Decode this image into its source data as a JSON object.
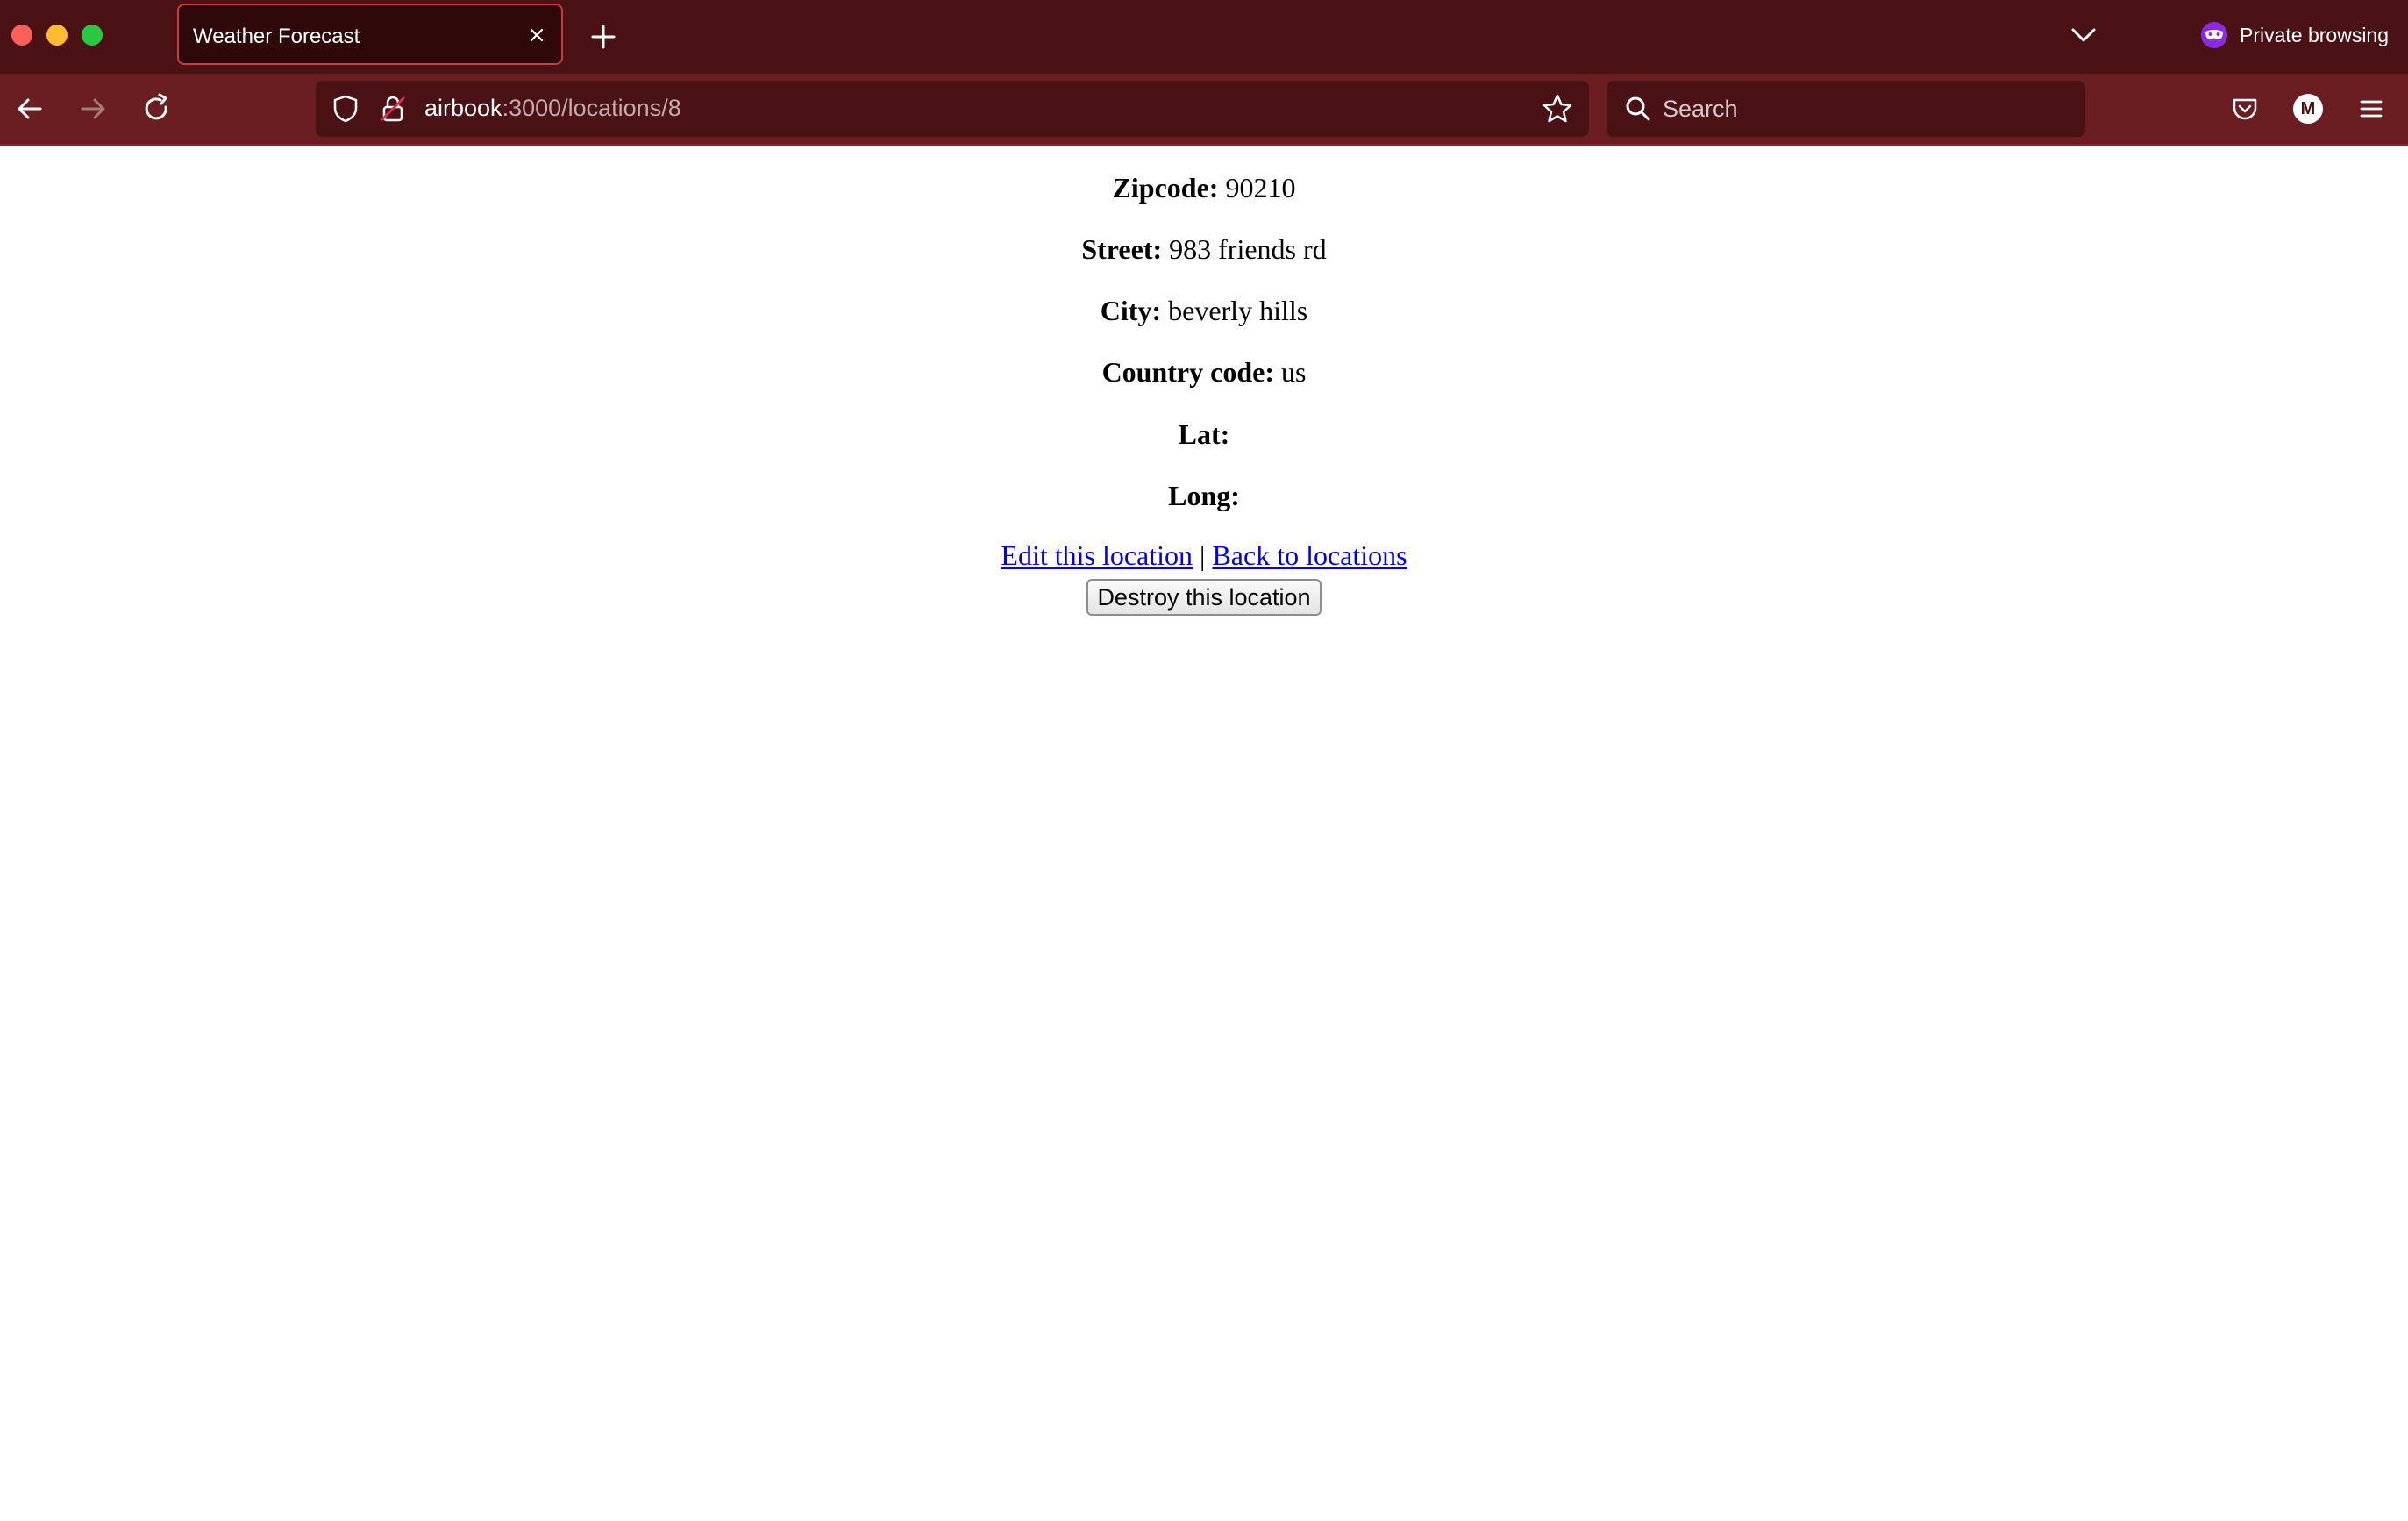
{
  "browser": {
    "tab_title": "Weather Forecast",
    "private_label": "Private browsing",
    "url_host": "airbook",
    "url_path": ":3000/locations/8",
    "search_placeholder": "Search",
    "account_initial": "M",
    "accent_color": "#4a1214",
    "nav_color": "#6a1e22",
    "private_icon_color": "#8a2be2"
  },
  "location": {
    "zipcode_label": "Zipcode:",
    "zipcode_value": "90210",
    "street_label": "Street:",
    "street_value": "983 friends rd",
    "city_label": "City:",
    "city_value": "beverly hills",
    "country_label": "Country code:",
    "country_value": "us",
    "lat_label": "Lat:",
    "lat_value": "",
    "long_label": "Long:",
    "long_value": ""
  },
  "actions": {
    "edit_link": "Edit this location",
    "separator": "|",
    "back_link": "Back to locations",
    "destroy_button": "Destroy this location"
  }
}
